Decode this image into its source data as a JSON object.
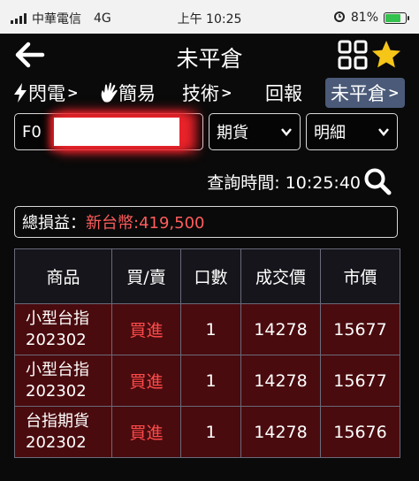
{
  "status_bar": {
    "carrier": "中華電信",
    "network": "4G",
    "time": "上午 10:25",
    "battery": "81%"
  },
  "header": {
    "title": "未平倉"
  },
  "tabs": [
    {
      "label": "閃電"
    },
    {
      "label": "簡易"
    },
    {
      "label": "技術"
    },
    {
      "label": "回報"
    },
    {
      "label": "未平倉"
    }
  ],
  "filters": {
    "account_prefix": "F0",
    "product_select": "期貨",
    "detail_select": "明細"
  },
  "query": {
    "label": "查詢時間:",
    "time": "10:25:40"
  },
  "pnl": {
    "label": "總損益：",
    "value": "新台幣:419,500"
  },
  "table": {
    "headers": [
      "商品",
      "買/賣",
      "口數",
      "成交價",
      "市價"
    ],
    "rows": [
      {
        "name": "小型台指",
        "contract": "202302",
        "side": "買進",
        "qty": "1",
        "price": "14278",
        "market": "15677"
      },
      {
        "name": "小型台指",
        "contract": "202302",
        "side": "買進",
        "qty": "1",
        "price": "14278",
        "market": "15677"
      },
      {
        "name": "台指期貨",
        "contract": "202302",
        "side": "買進",
        "qty": "1",
        "price": "14278",
        "market": "15676"
      }
    ]
  },
  "colors": {
    "profit": "#ff5c5c",
    "row_bg": "#4a0b0e",
    "active_tab": "#4a5a78",
    "star": "#f5c518"
  },
  "icons": {
    "back": "arrow-left-icon",
    "grid": "grid-icon",
    "favorite": "star-icon",
    "lightning": "lightning-icon",
    "hand": "hand-icon",
    "search": "search-icon"
  }
}
